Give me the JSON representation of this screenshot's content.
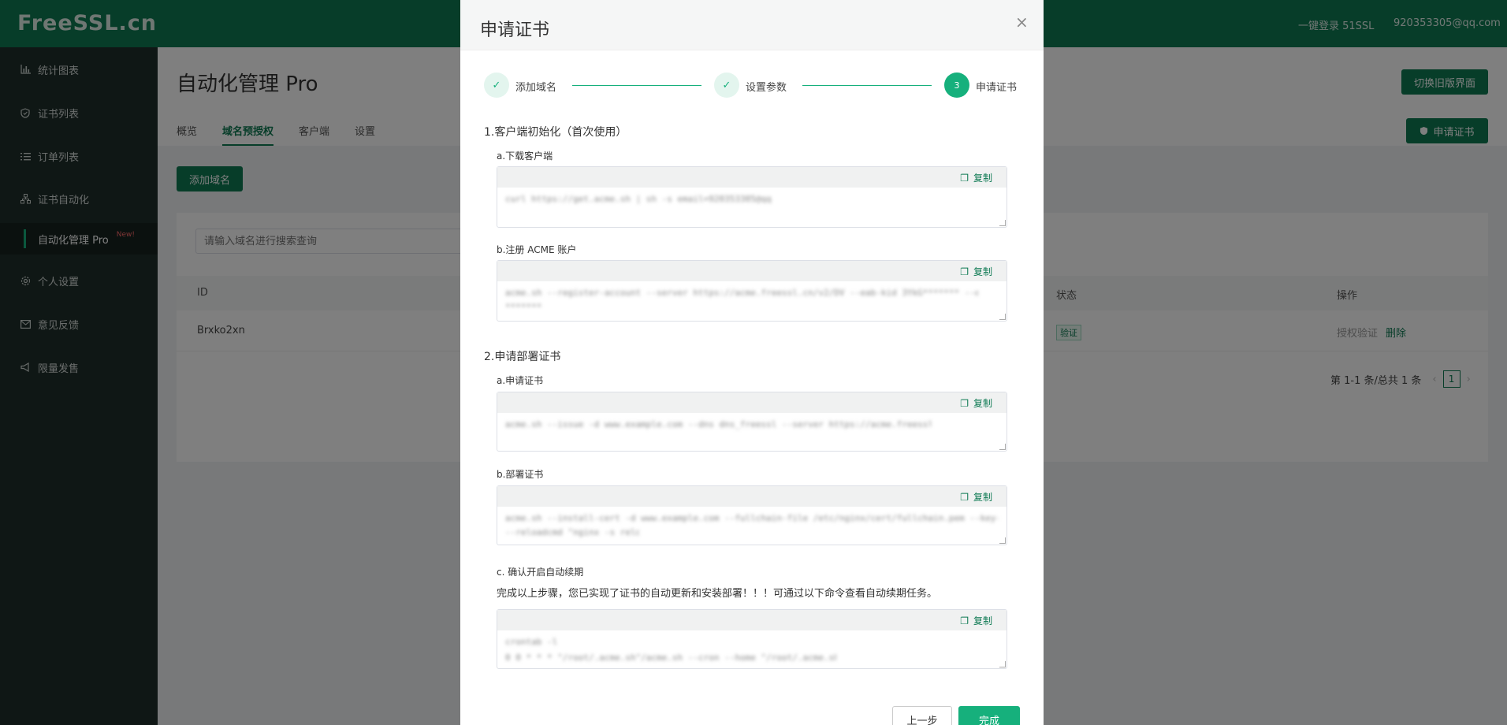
{
  "app": {
    "logo": "FreeSSL.cn",
    "login_link": "一键登录 51SSL",
    "user_email": "920353305@qq.com"
  },
  "sidebar": {
    "items": [
      {
        "label": "统计图表",
        "icon": "chart-icon"
      },
      {
        "label": "证书列表",
        "icon": "shield-icon"
      },
      {
        "label": "订单列表",
        "icon": "list-icon"
      },
      {
        "label": "证书自动化",
        "icon": "sitemap-icon"
      },
      {
        "label": "个人设置",
        "icon": "gear-icon"
      },
      {
        "label": "意见反馈",
        "icon": "mail-icon"
      },
      {
        "label": "限量发售",
        "icon": "megaphone-icon"
      }
    ],
    "sub_item": {
      "label": "自动化管理 Pro",
      "badge": "New!"
    }
  },
  "main": {
    "title": "自动化管理 Pro",
    "tabs": [
      "概览",
      "域名预授权",
      "客户端",
      "设置"
    ],
    "active_tab": "域名预授权",
    "switch_old_button": "切换旧版界面",
    "apply_cert_button": "申请证书",
    "add_domain_button": "添加域名",
    "search_placeholder": "请输入域名进行搜索查询",
    "table": {
      "headers": [
        "ID",
        "状态",
        "操作"
      ],
      "rows": [
        {
          "id": "Brxko2xn",
          "status": "验证",
          "actions": [
            "授权验证",
            "删除"
          ]
        }
      ]
    },
    "pagination": {
      "summary": "第 1-1 条/总共 1 条",
      "current": "1"
    }
  },
  "modal": {
    "title": "申请证书",
    "close": "×",
    "steps": [
      {
        "label": "添加域名",
        "state": "done",
        "mark": "✓"
      },
      {
        "label": "设置参数",
        "state": "done",
        "mark": "✓"
      },
      {
        "label": "申请证书",
        "state": "current",
        "mark": "3"
      }
    ],
    "section1": {
      "title": "1.客户端初始化（首次使用）",
      "a_title": "a.下载客户端",
      "a_code": "curl https://get.acme.sh | sh -s email=920353305@qq.com",
      "b_title": "b.注册 ACME 账户",
      "b_code_line1": "acme.sh --register-account --server https://acme.freessl.cn/v2/DV --eab-kid 3YkG******* --eab-hmac-key",
      "b_code_line2": "*******"
    },
    "section2": {
      "title": "2.申请部署证书",
      "a_title": "a.申请证书",
      "a_code": "acme.sh --issue -d www.example.com --dns dns_freessl --server https://acme.freessl.cn/v2/DV",
      "b_title": "b.部署证书",
      "b_code_line1": "acme.sh --install-cert -d www.example.com --fullchain-file /etc/nginx/cert/fullchain.pem --key-file /etc/nginx/cert/key.pem",
      "b_code_line2": "--reloadcmd \"nginx -s reload\"",
      "c_title": "c. 确认开启自动续期",
      "c_note": "完成以上步骤，您已实现了证书的自动更新和安装部署！！！可通过以下命令查看自动续期任务。",
      "c_code_line1": "crontab -l",
      "c_code_line2": "0 0 * * * \"/root/.acme.sh\"/acme.sh --cron --home \"/root/.acme.sh\" > /dev/null"
    },
    "copy_label": "复制",
    "prev_button": "上一步",
    "done_button": "完成"
  },
  "colors": {
    "brand": "#0e7a53",
    "accent": "#16b07c",
    "sidebar_bg": "#1f2f2b"
  }
}
